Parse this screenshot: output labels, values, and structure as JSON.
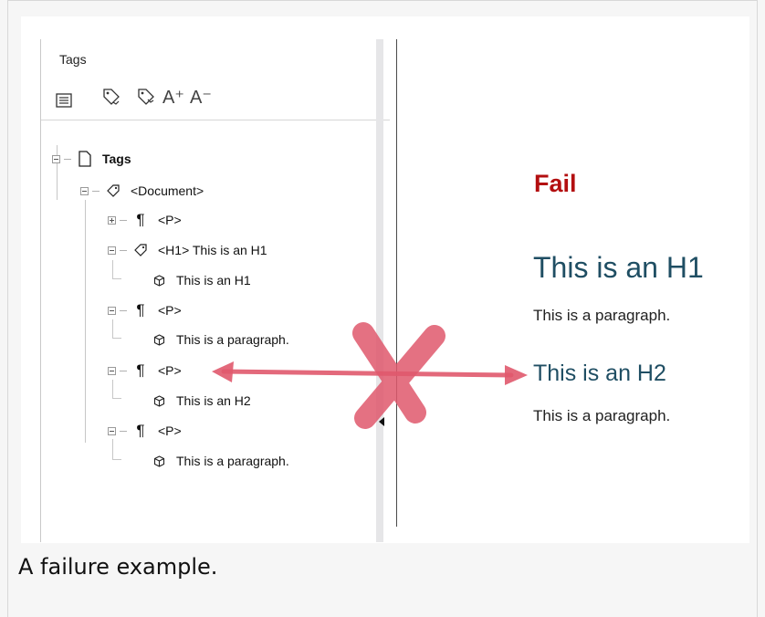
{
  "panel": {
    "title": "Tags",
    "toolbar": [
      {
        "icon": "options-menu-icon"
      },
      {
        "icon": "tag-add-icon"
      },
      {
        "icon": "tag-remove-icon"
      },
      {
        "icon": "font-increase-icon",
        "label": "A⁺"
      },
      {
        "icon": "font-decrease-icon",
        "label": "A⁻"
      }
    ],
    "tree": [
      {
        "label": "Tags",
        "icon": "document-icon",
        "expander": "minus"
      },
      {
        "label": "<Document>",
        "icon": "tag-icon",
        "expander": "minus"
      },
      {
        "label": "<P>",
        "icon": "paragraph-icon",
        "expander": "plus"
      },
      {
        "label": "<H1> This is an H1",
        "icon": "tag-icon",
        "expander": "minus"
      },
      {
        "label": "This is an H1",
        "icon": "content-cube-icon",
        "expander": "none"
      },
      {
        "label": "<P>",
        "icon": "paragraph-icon",
        "expander": "minus"
      },
      {
        "label": "This is a paragraph.",
        "icon": "content-cube-icon",
        "expander": "none"
      },
      {
        "label": "<P>",
        "icon": "paragraph-icon",
        "expander": "minus"
      },
      {
        "label": "This is an H2",
        "icon": "content-cube-icon",
        "expander": "none"
      },
      {
        "label": "<P>",
        "icon": "paragraph-icon",
        "expander": "minus"
      },
      {
        "label": "This is a paragraph.",
        "icon": "content-cube-icon",
        "expander": "none"
      }
    ]
  },
  "document": {
    "status": "Fail",
    "h1": "This is an H1",
    "para1": "This is a paragraph.",
    "h2": "This is an H2",
    "para2": "This is a paragraph."
  },
  "caption": "A failure example.",
  "colors": {
    "fail": "#b30f10",
    "heading": "#1f4e63",
    "annotation": "#e0596d"
  }
}
